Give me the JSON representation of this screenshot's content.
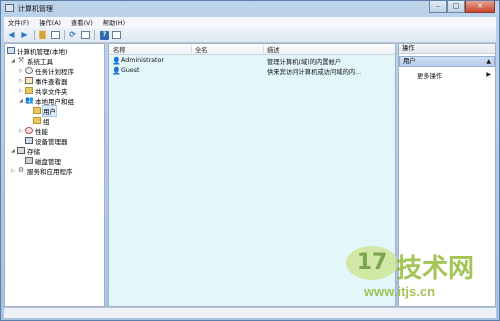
{
  "window": {
    "title": "计算机管理"
  },
  "menu": [
    {
      "label": "文件(F)"
    },
    {
      "label": "操作(A)"
    },
    {
      "label": "查看(V)"
    },
    {
      "label": "帮助(H)"
    }
  ],
  "toolbar": {
    "buttons": [
      "back-arrow-icon",
      "forward-arrow-icon",
      "up-folder-icon",
      "show-hide-tree-icon",
      "refresh-icon",
      "export-list-icon",
      "help-icon",
      "properties-icon"
    ]
  },
  "tree": [
    {
      "label": "计算机管理(本地)",
      "icon": "computer-icon",
      "expander": ""
    },
    {
      "label": "系统工具",
      "icon": "tools-icon",
      "expander": "◢"
    },
    {
      "label": "任务计划程序",
      "icon": "clock-icon",
      "expander": "▷"
    },
    {
      "label": "事件查看器",
      "icon": "event-log-icon",
      "expander": "▷"
    },
    {
      "label": "共享文件夹",
      "icon": "shared-folder-icon",
      "expander": "▷"
    },
    {
      "label": "本地用户和组",
      "icon": "users-icon",
      "expander": "◢"
    },
    {
      "label": "用户",
      "icon": "folder-icon",
      "expander": ""
    },
    {
      "label": "组",
      "icon": "folder-icon",
      "expander": ""
    },
    {
      "label": "性能",
      "icon": "performance-icon",
      "expander": "▷"
    },
    {
      "label": "设备管理器",
      "icon": "device-manager-icon",
      "expander": ""
    },
    {
      "label": "存储",
      "icon": "storage-icon",
      "expander": "◢"
    },
    {
      "label": "磁盘管理",
      "icon": "disk-icon",
      "expander": ""
    },
    {
      "label": "服务和应用程序",
      "icon": "services-icon",
      "expander": "▷"
    }
  ],
  "list": {
    "columns": [
      "名称",
      "全名",
      "描述"
    ],
    "rows": [
      {
        "name": "Administrator",
        "fullname": "",
        "description": "管理计算机(域)的内置帐户"
      },
      {
        "name": "Guest",
        "fullname": "",
        "description": "供来宾访问计算机或访问域的内..."
      }
    ]
  },
  "actions": {
    "title": "操作",
    "section": "用户",
    "section_arrow": "▲",
    "item": "更多操作",
    "item_arrow": "▶"
  },
  "watermark": {
    "logo": "17",
    "text": "技术网",
    "url": "www.itjs.cn"
  },
  "caption_buttons": [
    "–",
    "□",
    "✕"
  ]
}
